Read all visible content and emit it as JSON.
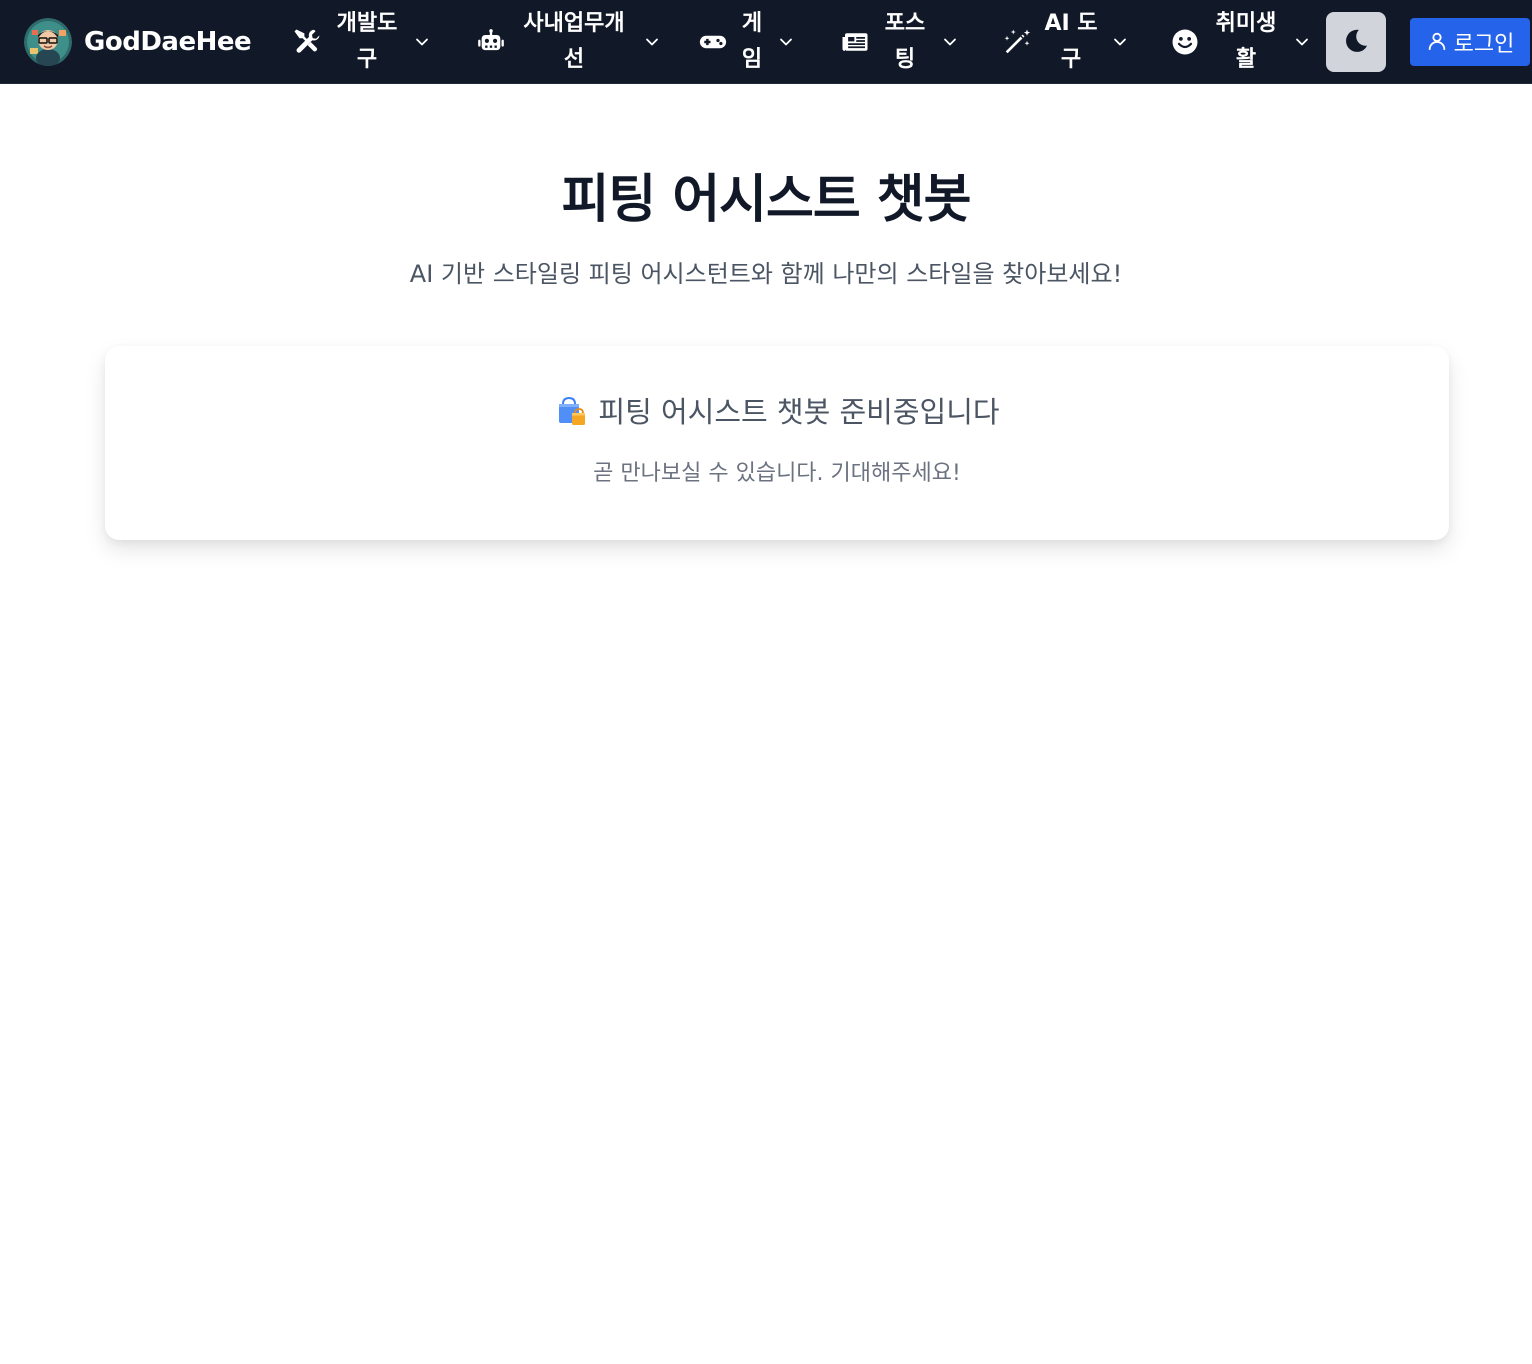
{
  "header": {
    "brand": {
      "name": "GodDaeHee",
      "logo_icon": "avatar-logo-icon"
    },
    "nav_items": [
      {
        "label": "개발도구",
        "icon": "tools-icon"
      },
      {
        "label": "사내업무개선",
        "icon": "robot-icon"
      },
      {
        "label": "게임",
        "icon": "gamepad-icon"
      },
      {
        "label": "포스팅",
        "icon": "newspaper-icon"
      },
      {
        "label": "AI 도구",
        "icon": "magic-wand-icon"
      },
      {
        "label": "취미생활",
        "icon": "smile-icon"
      }
    ],
    "theme_toggle_icon": "moon-icon",
    "login": {
      "label": "로그인",
      "icon": "user-icon"
    }
  },
  "main": {
    "title": "피팅 어시스트 챗봇",
    "subtitle": "AI 기반 스타일링 피팅 어시스턴트와 함께 나만의 스타일을 찾아보세요!",
    "notice": {
      "icon": "shopping-bags-icon",
      "heading": "피팅 어시스트 챗봇 준비중입니다",
      "message": "곧 만나보실 수 있습니다. 기대해주세요!"
    }
  },
  "colors": {
    "navbar_bg": "#111827",
    "accent_blue": "#2563eb",
    "toggle_bg": "#d1d5db",
    "title_text": "#111827",
    "subtitle_text": "#4b5563"
  }
}
